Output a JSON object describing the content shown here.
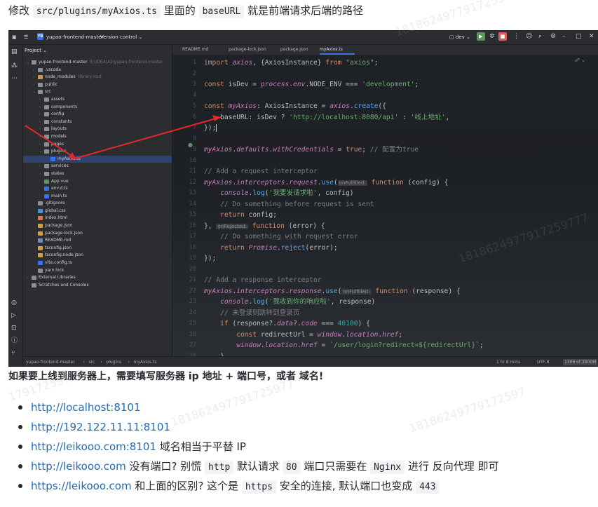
{
  "intro": {
    "prefix": "修改",
    "path": "src/plugins/myAxios.ts",
    "middle": "里面的",
    "key": "baseURL",
    "suffix": "就是前端请求后端的路径"
  },
  "ide": {
    "project_badge": "YB",
    "project_name": "yupao-frontend-master",
    "vcs_label": "Version control",
    "run_config": "dev",
    "panel_title": "Project",
    "tree": [
      {
        "label": "yupao-frontend-master",
        "extra": "E:\\IDEA\\A1\\yupao-frontend-master",
        "indent": 0,
        "arrow": "v",
        "icon": "folder"
      },
      {
        "label": ".vscode",
        "extra": "",
        "indent": 1,
        "arrow": ">",
        "icon": "folder"
      },
      {
        "label": "node_modules",
        "extra": "library root",
        "indent": 1,
        "arrow": ">",
        "icon": "folder-orange"
      },
      {
        "label": "public",
        "extra": "",
        "indent": 1,
        "arrow": ">",
        "icon": "folder"
      },
      {
        "label": "src",
        "extra": "",
        "indent": 1,
        "arrow": "v",
        "icon": "folder"
      },
      {
        "label": "assets",
        "extra": "",
        "indent": 2,
        "arrow": ">",
        "icon": "folder"
      },
      {
        "label": "components",
        "extra": "",
        "indent": 2,
        "arrow": ">",
        "icon": "folder"
      },
      {
        "label": "config",
        "extra": "",
        "indent": 2,
        "arrow": ">",
        "icon": "folder"
      },
      {
        "label": "constants",
        "extra": "",
        "indent": 2,
        "arrow": ">",
        "icon": "folder"
      },
      {
        "label": "layouts",
        "extra": "",
        "indent": 2,
        "arrow": ">",
        "icon": "folder"
      },
      {
        "label": "models",
        "extra": "",
        "indent": 2,
        "arrow": ">",
        "icon": "folder"
      },
      {
        "label": "pages",
        "extra": "",
        "indent": 2,
        "arrow": ">",
        "icon": "folder"
      },
      {
        "label": "plugins",
        "extra": "",
        "indent": 2,
        "arrow": "v",
        "icon": "folder"
      },
      {
        "label": "myAxios.ts",
        "extra": "",
        "indent": 3,
        "arrow": "",
        "icon": "ts",
        "selected": true
      },
      {
        "label": "services",
        "extra": "",
        "indent": 2,
        "arrow": ">",
        "icon": "folder"
      },
      {
        "label": "states",
        "extra": "",
        "indent": 2,
        "arrow": ">",
        "icon": "folder"
      },
      {
        "label": "App.vue",
        "extra": "",
        "indent": 2,
        "arrow": "",
        "icon": "vue"
      },
      {
        "label": "env.d.ts",
        "extra": "",
        "indent": 2,
        "arrow": "",
        "icon": "ts"
      },
      {
        "label": "main.ts",
        "extra": "",
        "indent": 2,
        "arrow": "",
        "icon": "ts"
      },
      {
        "label": ".gitignore",
        "extra": "",
        "indent": 1,
        "arrow": "",
        "icon": "text"
      },
      {
        "label": "global.css",
        "extra": "",
        "indent": 1,
        "arrow": "",
        "icon": "css"
      },
      {
        "label": "index.html",
        "extra": "",
        "indent": 1,
        "arrow": "",
        "icon": "html"
      },
      {
        "label": "package.json",
        "extra": "",
        "indent": 1,
        "arrow": "",
        "icon": "json"
      },
      {
        "label": "package-lock.json",
        "extra": "",
        "indent": 1,
        "arrow": "",
        "icon": "json"
      },
      {
        "label": "README.md",
        "extra": "",
        "indent": 1,
        "arrow": "",
        "icon": "md"
      },
      {
        "label": "tsconfig.json",
        "extra": "",
        "indent": 1,
        "arrow": "",
        "icon": "json"
      },
      {
        "label": "tsconfig.node.json",
        "extra": "",
        "indent": 1,
        "arrow": "",
        "icon": "json"
      },
      {
        "label": "vite.config.ts",
        "extra": "",
        "indent": 1,
        "arrow": "",
        "icon": "ts"
      },
      {
        "label": "yarn.lock",
        "extra": "",
        "indent": 1,
        "arrow": "",
        "icon": "text"
      },
      {
        "label": "External Libraries",
        "extra": "",
        "indent": 0,
        "arrow": ">",
        "icon": "lib"
      },
      {
        "label": "Scratches and Consoles",
        "extra": "",
        "indent": 0,
        "arrow": "",
        "icon": "scratch"
      }
    ],
    "tabs": [
      "README.md",
      "package-lock.json",
      "package.json",
      "myAxios.ts"
    ],
    "code_lines": [
      {
        "n": "1",
        "tokens": [
          [
            "k",
            "import "
          ],
          [
            "iv",
            "axios"
          ],
          [
            "p",
            ", {AxiosInstance} "
          ],
          [
            "k",
            "from "
          ],
          [
            "s",
            "\"axios\""
          ],
          [
            "p",
            ";"
          ]
        ]
      },
      {
        "n": "2",
        "tokens": []
      },
      {
        "n": "3",
        "tokens": [
          [
            "k",
            "const "
          ],
          [
            "p",
            "isDev = "
          ],
          [
            "iv",
            "process"
          ],
          [
            "p",
            "."
          ],
          [
            "iv",
            "env"
          ],
          [
            "p",
            ".NODE_ENV === "
          ],
          [
            "s",
            "'development'"
          ],
          [
            "p",
            ";"
          ]
        ]
      },
      {
        "n": "4",
        "tokens": []
      },
      {
        "n": "5",
        "tokens": [
          [
            "k",
            "const "
          ],
          [
            "iv",
            "myAxios"
          ],
          [
            "p",
            ": AxiosInstance = "
          ],
          [
            "iv",
            "axios"
          ],
          [
            "p",
            "."
          ],
          [
            "f",
            "create"
          ],
          [
            "p",
            "({"
          ]
        ]
      },
      {
        "n": "6",
        "tokens": [
          [
            "p",
            "    baseURL: isDev ? "
          ],
          [
            "s",
            "'http://localhost:8080/api'"
          ],
          [
            "p",
            " : "
          ],
          [
            "s",
            "'线上地址'"
          ],
          [
            "p",
            ","
          ]
        ]
      },
      {
        "n": "7",
        "tokens": [
          [
            "p",
            "});"
          ],
          [
            "caret",
            ""
          ]
        ]
      },
      {
        "n": "8",
        "tokens": []
      },
      {
        "n": "9",
        "tokens": [
          [
            "iv",
            "myAxios"
          ],
          [
            "p",
            "."
          ],
          [
            "iv",
            "defaults"
          ],
          [
            "p",
            "."
          ],
          [
            "iv",
            "withCredentials"
          ],
          [
            "p",
            " = "
          ],
          [
            "k",
            "true"
          ],
          [
            "p",
            "; "
          ],
          [
            "c",
            "// 配置为true"
          ]
        ]
      },
      {
        "n": "10",
        "tokens": []
      },
      {
        "n": "11",
        "tokens": [
          [
            "c",
            "// Add a request interceptor"
          ]
        ]
      },
      {
        "n": "12",
        "tokens": [
          [
            "iv",
            "myAxios"
          ],
          [
            "p",
            "."
          ],
          [
            "iv",
            "interceptors"
          ],
          [
            "p",
            "."
          ],
          [
            "iv",
            "request"
          ],
          [
            "p",
            "."
          ],
          [
            "f",
            "use"
          ],
          [
            "p",
            "("
          ],
          [
            "hint",
            "onFulfilled:"
          ],
          [
            "k",
            " function "
          ],
          [
            "p",
            "(config) {"
          ]
        ]
      },
      {
        "n": "13",
        "tokens": [
          [
            "p",
            "    "
          ],
          [
            "iv",
            "console"
          ],
          [
            "p",
            "."
          ],
          [
            "f",
            "log"
          ],
          [
            "p",
            "("
          ],
          [
            "s",
            "'我要发请求啦'"
          ],
          [
            "p",
            ", config)"
          ]
        ]
      },
      {
        "n": "14",
        "tokens": [
          [
            "c",
            "    // Do something before request is sent"
          ]
        ]
      },
      {
        "n": "15",
        "tokens": [
          [
            "k",
            "    return "
          ],
          [
            "p",
            "config;"
          ]
        ]
      },
      {
        "n": "16",
        "tokens": [
          [
            "p",
            "}, "
          ],
          [
            "hint",
            "onRejected:"
          ],
          [
            "k",
            " function "
          ],
          [
            "p",
            "(error) {"
          ]
        ]
      },
      {
        "n": "17",
        "tokens": [
          [
            "c",
            "    // Do something with request error"
          ]
        ]
      },
      {
        "n": "18",
        "tokens": [
          [
            "k",
            "    return "
          ],
          [
            "iv",
            "Promise"
          ],
          [
            "p",
            "."
          ],
          [
            "f",
            "reject"
          ],
          [
            "p",
            "(error);"
          ]
        ]
      },
      {
        "n": "19",
        "tokens": [
          [
            "p",
            "});"
          ]
        ]
      },
      {
        "n": "20",
        "tokens": []
      },
      {
        "n": "21",
        "tokens": [
          [
            "c",
            "// Add a response interceptor"
          ]
        ]
      },
      {
        "n": "22",
        "tokens": [
          [
            "iv",
            "myAxios"
          ],
          [
            "p",
            "."
          ],
          [
            "iv",
            "interceptors"
          ],
          [
            "p",
            "."
          ],
          [
            "iv",
            "response"
          ],
          [
            "p",
            "."
          ],
          [
            "f",
            "use"
          ],
          [
            "p",
            "("
          ],
          [
            "hint",
            "onFulfilled:"
          ],
          [
            "k",
            " function "
          ],
          [
            "p",
            "(response) {"
          ]
        ]
      },
      {
        "n": "23",
        "tokens": [
          [
            "p",
            "    "
          ],
          [
            "iv",
            "console"
          ],
          [
            "p",
            "."
          ],
          [
            "f",
            "log"
          ],
          [
            "p",
            "("
          ],
          [
            "s",
            "'我收到你的响应啦'"
          ],
          [
            "p",
            ", response)"
          ]
        ]
      },
      {
        "n": "24",
        "tokens": [
          [
            "c",
            "    // 未登录则跳转到登录页"
          ]
        ]
      },
      {
        "n": "25",
        "tokens": [
          [
            "k",
            "    if "
          ],
          [
            "p",
            "(response?."
          ],
          [
            "iv",
            "data"
          ],
          [
            "p",
            "?."
          ],
          [
            "iv",
            "code"
          ],
          [
            "p",
            " === "
          ],
          [
            "n",
            "40100"
          ],
          [
            "p",
            ") {"
          ]
        ]
      },
      {
        "n": "26",
        "tokens": [
          [
            "k",
            "        const "
          ],
          [
            "p",
            "redirectUrl = "
          ],
          [
            "iv",
            "window"
          ],
          [
            "p",
            "."
          ],
          [
            "iv",
            "location"
          ],
          [
            "p",
            "."
          ],
          [
            "iv",
            "href"
          ],
          [
            "p",
            ";"
          ]
        ]
      },
      {
        "n": "27",
        "tokens": [
          [
            "iv",
            "        window"
          ],
          [
            "p",
            "."
          ],
          [
            "iv",
            "location"
          ],
          [
            "p",
            "."
          ],
          [
            "iv",
            "href"
          ],
          [
            "p",
            " = "
          ],
          [
            "s",
            "`/user/login?redirect=${redirectUrl}`"
          ],
          [
            "p",
            ";"
          ]
        ]
      },
      {
        "n": "28",
        "tokens": [
          [
            "p",
            "    }"
          ]
        ]
      }
    ],
    "breadcrumb": [
      "yupao-frontend-master",
      "src",
      "plugins",
      "myAxios.ts"
    ],
    "status_right": [
      "1 hr 8 mins",
      "UTF-8",
      "1306 of 3800M"
    ],
    "arrow_color": "#e5262b"
  },
  "heading": "如果要上线到服务器上，需要填写服务器 ip 地址 + 端口号，或者 域名!",
  "bullets": [
    {
      "link": "http://localhost:8101",
      "parts": []
    },
    {
      "link": "http://192.122.11.11:8101",
      "parts": []
    },
    {
      "link": "http://leikooo.com:8101",
      "parts": [
        [
          "t",
          " 域名相当于平替 IP"
        ]
      ]
    },
    {
      "link": "http://leikooo.com",
      "parts": [
        [
          "t",
          " 没有端口? 别慌 "
        ],
        [
          "code",
          "http"
        ],
        [
          "t",
          " 默认请求 "
        ],
        [
          "code",
          "80"
        ],
        [
          "t",
          " 端口只需要在 "
        ],
        [
          "code",
          "Nginx"
        ],
        [
          "t",
          " 进行 反向代理 即可"
        ]
      ]
    },
    {
      "link": "https://leikooo.com",
      "parts": [
        [
          "t",
          " 和上面的区别? 这个是 "
        ],
        [
          "code",
          "https"
        ],
        [
          "t",
          " 安全的连接, 默认端口也变成 "
        ],
        [
          "code",
          "443"
        ]
      ]
    }
  ],
  "watermark": [
    "18186249779172597",
    "17917259777",
    "181862497791725977",
    "18186249779172597",
    "1818624977917259777"
  ]
}
